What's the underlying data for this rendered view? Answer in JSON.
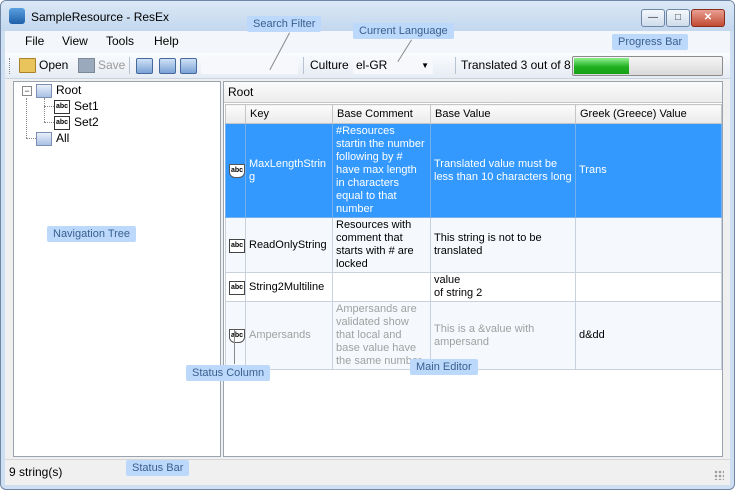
{
  "window": {
    "title": "SampleResource - ResEx"
  },
  "menu": [
    "File",
    "View",
    "Tools",
    "Help"
  ],
  "toolbar": {
    "open_label": "Open",
    "save_label": "Save",
    "culture_label": "Culture",
    "culture_value": "el-GR",
    "progress_text": "Translated 3 out of 8",
    "progress": 0.375
  },
  "tree": {
    "root": "Root",
    "children": [
      "Set1",
      "Set2"
    ],
    "sibling": "All"
  },
  "editor": {
    "header": "Root",
    "columns": [
      "Key",
      "Base Comment",
      "Base Value",
      "Greek (Greece) Value"
    ],
    "rows": [
      {
        "icon": "abc",
        "key": "MaxLengthString",
        "comment": "#Resources startin the number following by # have max length in characters equal to that number",
        "value": "Translated value must be less than 10 characters long",
        "translation": "Trans"
      },
      {
        "icon": "abc",
        "key": "ReadOnlyString",
        "comment": "Resources with comment that starts with # are locked",
        "value": "This string is not to be translated",
        "translation": ""
      },
      {
        "icon": "abc",
        "key": "String2Multiline",
        "comment": "",
        "value": "value\nof string 2",
        "translation": ""
      },
      {
        "icon": "abc",
        "key": "Ampersands",
        "comment": "Ampersands are validated show that local and base value have the same number",
        "value": "This is a &value with ampersand",
        "translation": "d&dd"
      }
    ]
  },
  "status": {
    "text": "9 string(s)"
  },
  "callouts": {
    "search_filter": "Search Filter",
    "current_language": "Current Language",
    "progress_bar": "Progress Bar",
    "navigation_tree": "Navigation Tree",
    "main_editor": "Main Editor",
    "status_column": "Status Column",
    "status_bar": "Status Bar"
  },
  "colors": {
    "selection": "#3399ff",
    "progress_green": "#22b022",
    "callout_bg": "#bcd9fb"
  }
}
